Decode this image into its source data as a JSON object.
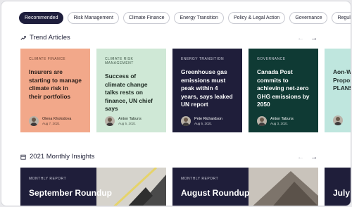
{
  "tabs": [
    "Recommended",
    "Risk Management",
    "Climate Finance",
    "Energy Transition",
    "Policy & Legal Action",
    "Governance",
    "Regulation & Reporting"
  ],
  "trend": {
    "title": "Trend Articles"
  },
  "cards": [
    {
      "category": "CLIMATE FINANCE",
      "title": "Insurers are starting to manage climate risk in their portfolios",
      "author": "Olena Kholodova",
      "date": "Aug 7, 2021"
    },
    {
      "category": "CLIMATE RISK MANAGEMENT",
      "title": "Success of climate change talks rests on finance, UN chief says",
      "author": "Anton Tabuns",
      "date": "Aug 5, 2021"
    },
    {
      "category": "ENERGY TRANSITION",
      "title": "Greenhouse gas emissions must peak within 4 years, says leaked UN report",
      "author": "Pete Richardson",
      "date": "Aug 5, 2021"
    },
    {
      "category": "GOVERNANCE",
      "title": "Canada Post commits to achieving net-zero GHG emissions by 2050",
      "author": "Anton Tabuns",
      "date": "Aug 3, 2021"
    },
    {
      "category": "",
      "title": "Aon-W Sust Propos PLANSF",
      "author": "",
      "date": ""
    }
  ],
  "insights": {
    "title": "2021 Monthly Insights",
    "items": [
      {
        "label": "MONTHLY REPORT",
        "title": "September Roundup"
      },
      {
        "label": "MONTHLY REPORT",
        "title": "August Roundup"
      },
      {
        "label": "",
        "title": "July R"
      }
    ]
  },
  "icons": {
    "trend": "trend-up-icon",
    "insights": "calendar-icon",
    "prev": "arrow-left-icon",
    "next": "arrow-right-icon"
  }
}
